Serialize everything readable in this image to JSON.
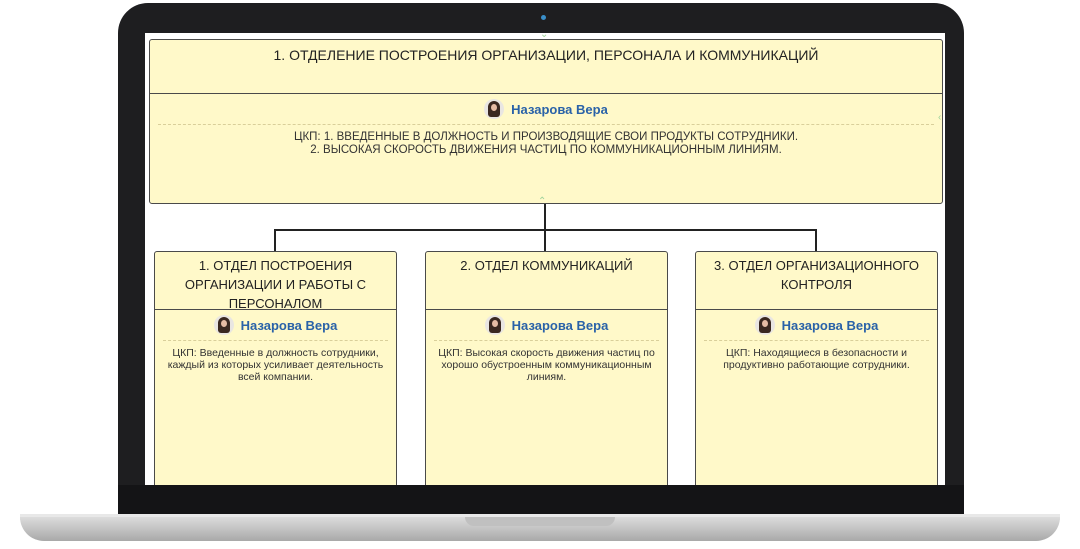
{
  "top": {
    "title": "1. ОТДЕЛЕНИЕ ПОСТРОЕНИЯ ОРГАНИЗАЦИИ, ПЕРСОНАЛА И КОММУНИКАЦИЙ",
    "person": "Назарова Вера",
    "goal_line1": "ЦКП: 1. ВВЕДЕННЫЕ В ДОЛЖНОСТЬ И ПРОИЗВОДЯЩИЕ СВОИ ПРОДУКТЫ СОТРУДНИКИ.",
    "goal_line2": "2. ВЫСОКАЯ СКОРОСТЬ ДВИЖЕНИЯ ЧАСТИЦ ПО КОММУНИКАЦИОННЫМ ЛИНИЯМ."
  },
  "departments": [
    {
      "title": "1. ОТДЕЛ ПОСТРОЕНИЯ ОРГАНИЗАЦИИ И РАБОТЫ С ПЕРСОНАЛОМ",
      "person": "Назарова Вера",
      "goal": "ЦКП: Введенные в должность сотрудники, каждый из которых усиливает деятельность всей компании."
    },
    {
      "title": "2. ОТДЕЛ КОММУНИКАЦИЙ",
      "person": "Назарова Вера",
      "goal": "ЦКП: Высокая скорость движения частиц по хорошо обустроенным коммуникационным линиям."
    },
    {
      "title": "3. ОТДЕЛ ОРГАНИЗАЦИОННОГО КОНТРОЛЯ",
      "person": "Назарова Вера",
      "goal": "ЦКП: Находящиеся в безопасности и продуктивно работающие сотрудники."
    }
  ],
  "colors": {
    "node_bg": "#fff9c9",
    "name": "#2a62a8",
    "chevron": "#9fd39b"
  },
  "icons": {
    "avatar": "person-avatar-icon",
    "expand": "chevron-icon"
  }
}
